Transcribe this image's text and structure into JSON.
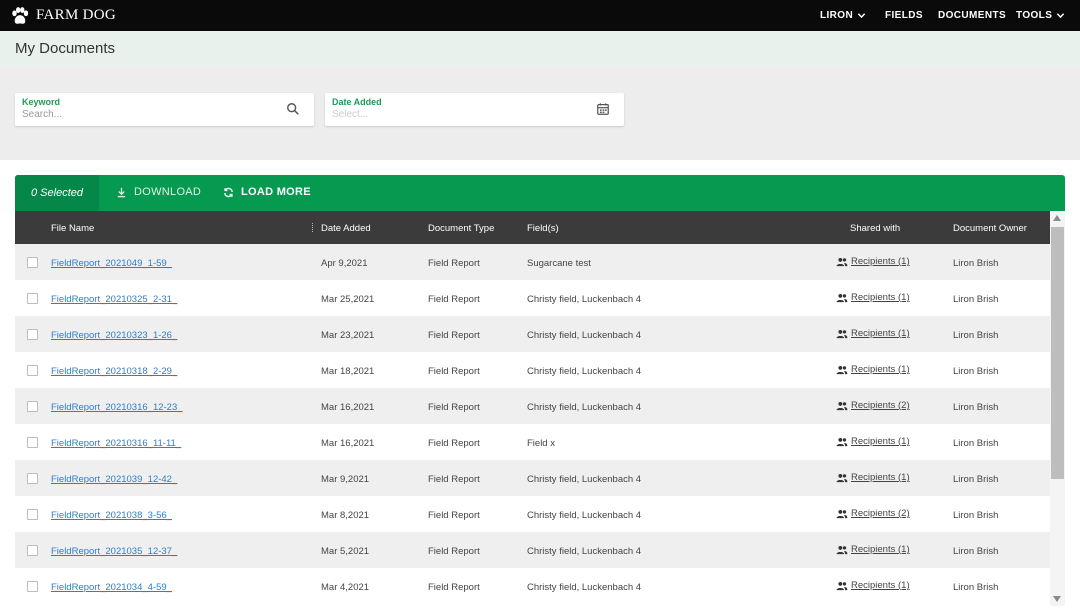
{
  "app": {
    "brand": "FARM DOG",
    "nav": {
      "user": "LIRON",
      "fields": "FIELDS",
      "documents": "DOCUMENTS",
      "tools": "TOOLS"
    }
  },
  "page": {
    "title": "My Documents"
  },
  "filters": {
    "keyword": {
      "label": "Keyword",
      "placeholder": "Search...",
      "value": ""
    },
    "date_added": {
      "label": "Date Added",
      "placeholder": "Select...",
      "value": ""
    }
  },
  "actions": {
    "selected": "0 Selected",
    "download": "DOWNLOAD",
    "load_more": "LOAD MORE"
  },
  "table": {
    "columns": {
      "file_name": "File Name",
      "date_added": "Date Added",
      "document_type": "Document Type",
      "fields": "Field(s)",
      "shared_with": "Shared with",
      "owner": "Document Owner"
    },
    "rows": [
      {
        "file": "FieldReport_2021049_1-59_",
        "date": "Apr 9,2021",
        "type": "Field Report",
        "fields": "Sugarcane test",
        "shared": "Recipients (1)",
        "owner": "Liron Brish"
      },
      {
        "file": "FieldReport_20210325_2-31_",
        "date": "Mar 25,2021",
        "type": "Field Report",
        "fields": "Christy field, Luckenbach 4",
        "shared": "Recipients (1)",
        "owner": "Liron Brish"
      },
      {
        "file": "FieldReport_20210323_1-26_",
        "date": "Mar 23,2021",
        "type": "Field Report",
        "fields": "Christy field, Luckenbach 4",
        "shared": "Recipients (1)",
        "owner": "Liron Brish"
      },
      {
        "file": "FieldReport_20210318_2-29_",
        "date": "Mar 18,2021",
        "type": "Field Report",
        "fields": "Christy field, Luckenbach 4",
        "shared": "Recipients (1)",
        "owner": "Liron Brish"
      },
      {
        "file": "FieldReport_20210316_12-23_",
        "date": "Mar 16,2021",
        "type": "Field Report",
        "fields": "Christy field, Luckenbach 4",
        "shared": "Recipients (2)",
        "owner": "Liron Brish"
      },
      {
        "file": "FieldReport_20210316_11-11_",
        "date": "Mar 16,2021",
        "type": "Field Report",
        "fields": "Field x",
        "shared": "Recipients (1)",
        "owner": "Liron Brish"
      },
      {
        "file": "FieldReport_2021039_12-42_",
        "date": "Mar 9,2021",
        "type": "Field Report",
        "fields": "Christy field, Luckenbach 4",
        "shared": "Recipients (1)",
        "owner": "Liron Brish"
      },
      {
        "file": "FieldReport_2021038_3-56_",
        "date": "Mar 8,2021",
        "type": "Field Report",
        "fields": "Christy field, Luckenbach 4",
        "shared": "Recipients (2)",
        "owner": "Liron Brish"
      },
      {
        "file": "FieldReport_2021035_12-37_",
        "date": "Mar 5,2021",
        "type": "Field Report",
        "fields": "Christy field, Luckenbach 4",
        "shared": "Recipients (1)",
        "owner": "Liron Brish"
      },
      {
        "file": "FieldReport_2021034_4-59_",
        "date": "Mar 4,2021",
        "type": "Field Report",
        "fields": "Christy field, Luckenbach 4",
        "shared": "Recipients (1)",
        "owner": "Liron Brish"
      }
    ]
  },
  "colors": {
    "topbar": "#0a0a0a",
    "accent_green": "#069a50",
    "label_green": "#1d9c56",
    "link_blue": "#2d7fc7",
    "header_dark": "#3b3b3b"
  },
  "icons": {
    "brand": "paw-icon",
    "dropdown": "chevron-down-icon",
    "search": "search-icon",
    "calendar": "calendar-icon",
    "download": "download-icon",
    "refresh": "refresh-icon",
    "recipients": "people-icon"
  }
}
